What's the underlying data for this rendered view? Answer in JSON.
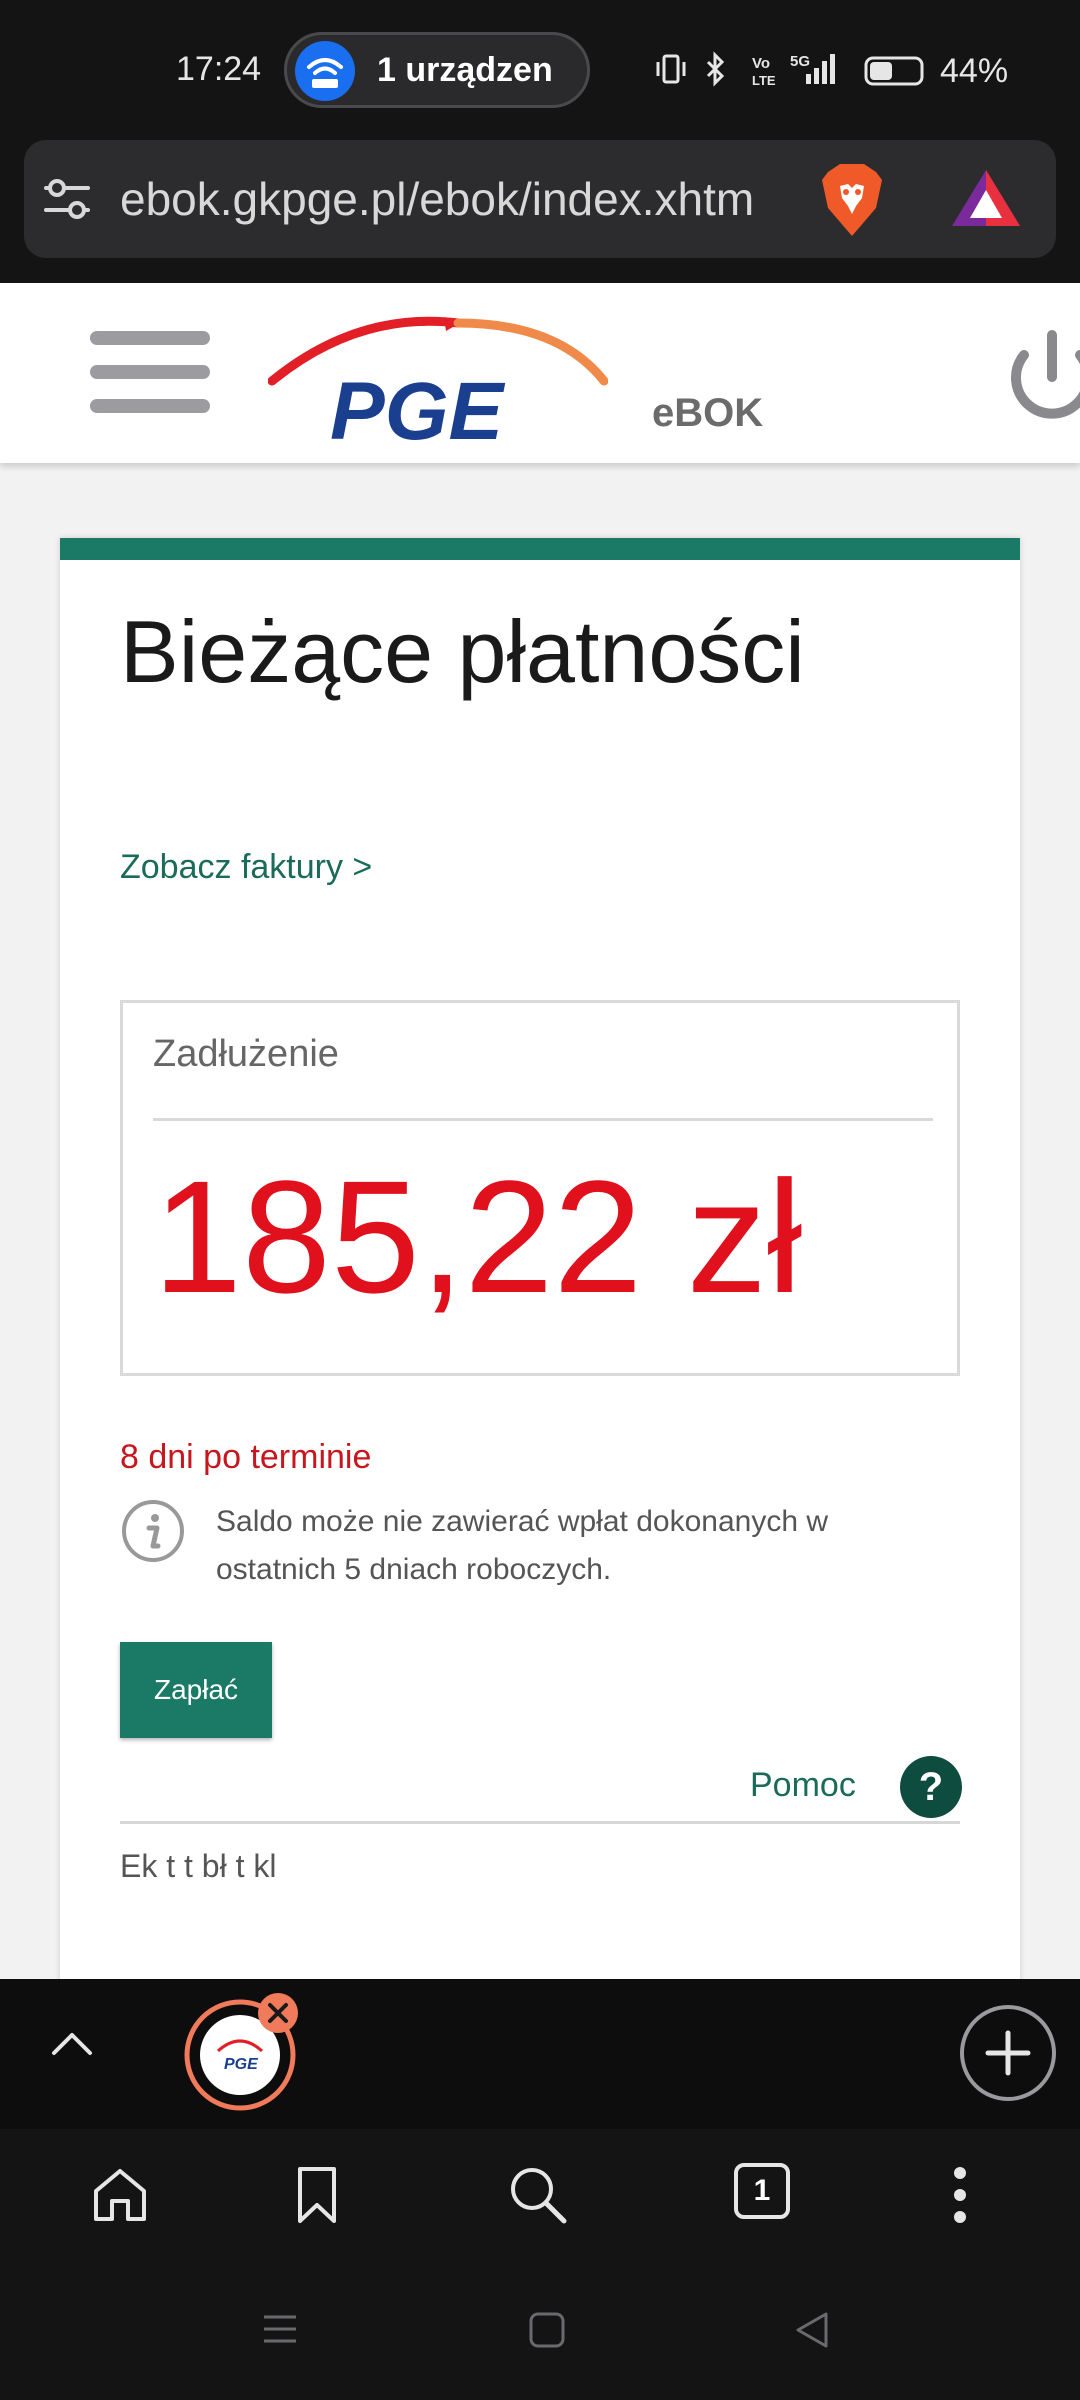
{
  "status_bar": {
    "time": "17:24",
    "hotspot_label": "1 urządzen",
    "battery": "44%",
    "icons": [
      "vibrate-icon",
      "bluetooth-icon",
      "volte-icon",
      "5g-signal-icon",
      "battery-icon"
    ]
  },
  "browser": {
    "url": "ebok.gkpge.pl/ebok/index.xhtm",
    "tab_count": "1",
    "tab_favicon_text": "PGE"
  },
  "site": {
    "logo_text": "PGE",
    "ebok": "eBOK"
  },
  "card": {
    "title": "Bieżące płatności",
    "invoices_link": "Zobacz faktury >",
    "debt_label": "Zadłużenie",
    "debt_amount": "185,22 zł",
    "overdue": "8 dni po terminie",
    "info": "Saldo może nie zawierać wpłat dokonanych w ostatnich 5 dniach roboczych.",
    "pay_button": "Zapłać",
    "help": "Pomoc",
    "help_icon": "?",
    "cut_text": "Ek         t  t      bł t         kl"
  },
  "colors": {
    "brand_green": "#1b7a66",
    "debt_red": "#e0101d",
    "overdue_red": "#c8161e",
    "logo_blue": "#1a3f8f"
  }
}
